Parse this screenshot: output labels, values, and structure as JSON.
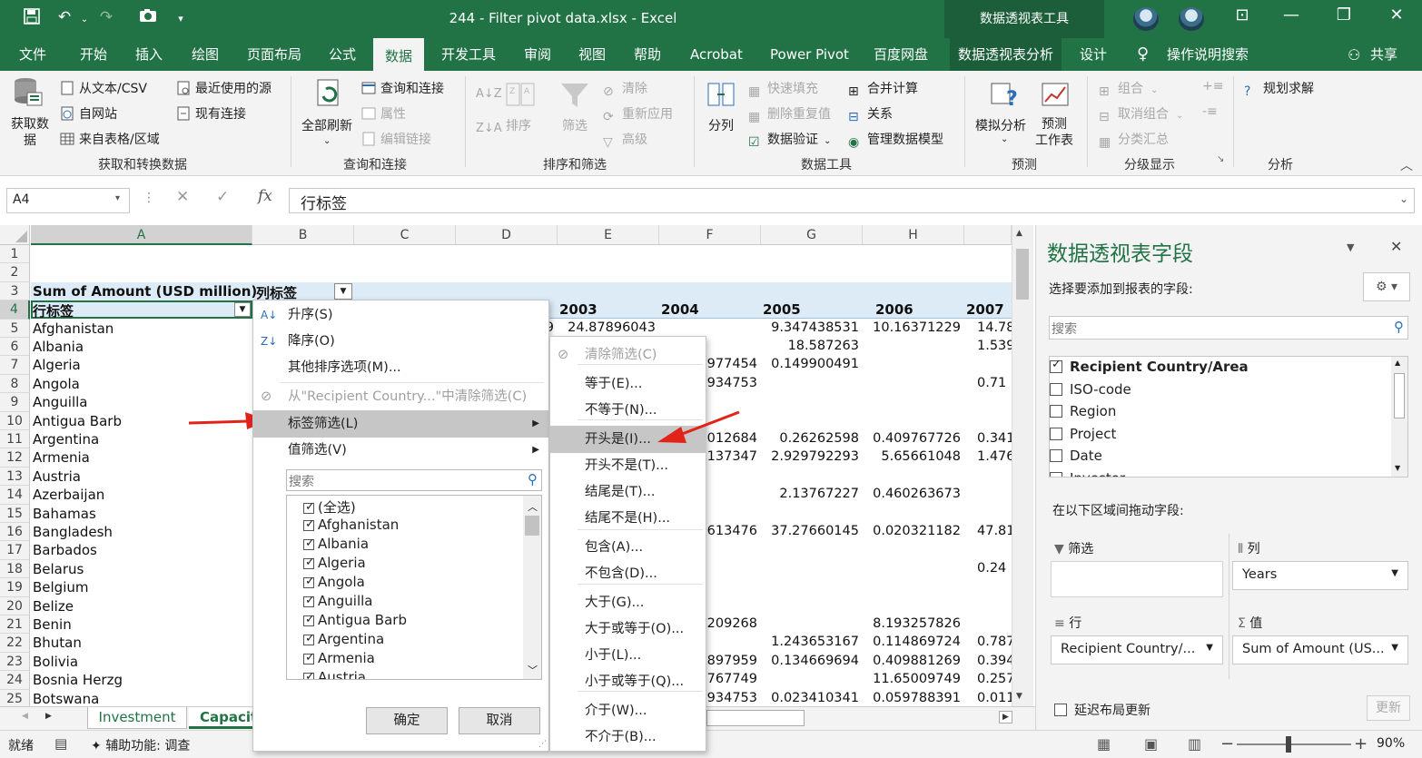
{
  "window": {
    "title": "244 - Filter pivot data.xlsx  -  Excel",
    "context_title": "数据透视表工具"
  },
  "tabs": [
    "文件",
    "开始",
    "插入",
    "绘图",
    "页面布局",
    "公式",
    "数据",
    "开发工具",
    "审阅",
    "视图",
    "帮助",
    "Acrobat",
    "Power Pivot",
    "百度网盘",
    "数据透视表分析",
    "设计",
    "操作说明搜索",
    "共享"
  ],
  "ribbon": {
    "get_data": "获取数\n据",
    "from_text": "从文本/CSV",
    "from_web": "自网站",
    "from_table": "来自表格/区域",
    "recent": "最近使用的源",
    "existing": "现有连接",
    "grp1": "获取和转换数据",
    "refresh_all": "全部刷新",
    "queries": "查询和连接",
    "properties": "属性",
    "edit_links": "编辑链接",
    "grp2": "查询和连接",
    "sort": "排序",
    "filter": "筛选",
    "clear": "清除",
    "reapply": "重新应用",
    "advanced": "高级",
    "grp3": "排序和筛选",
    "split": "分列",
    "flash_fill": "快速填充",
    "remove_dup": "删除重复值",
    "validation": "数据验证",
    "consolidate": "合并计算",
    "relations": "关系",
    "data_model": "管理数据模型",
    "grp4": "数据工具",
    "what_if": "模拟分析",
    "forecast": "预测\n工作表",
    "grp5": "预测",
    "group": "组合",
    "ungroup": "取消组合",
    "subtotal": "分类汇总",
    "grp6": "分级显示",
    "solver": "规划求解",
    "grp7": "分析"
  },
  "formula_bar": {
    "name_box": "A4",
    "fx": "fx",
    "content": "行标签"
  },
  "grid": {
    "columns": [
      "A",
      "B",
      "C",
      "D",
      "E",
      "F",
      "G",
      "H"
    ],
    "rows": [
      "1",
      "2",
      "3",
      "4",
      "5",
      "6",
      "7",
      "8",
      "9",
      "10",
      "11",
      "12",
      "13",
      "14",
      "15",
      "16",
      "17",
      "18",
      "19",
      "20",
      "21",
      "22",
      "23",
      "24",
      "25"
    ],
    "a3": "Sum of Amount (USD million)",
    "b3": "列标签",
    "a4": "行标签",
    "years": [
      "2003",
      "2004",
      "2005",
      "2006",
      "2007"
    ],
    "countries": [
      "Afghanistan",
      "Albania",
      "Algeria",
      "Angola",
      "Anguilla",
      "Antigua Barb",
      "Argentina",
      "Armenia",
      "Austria",
      "Azerbaijan",
      "Bahamas",
      "Bangladesh",
      "Barbados",
      "Belarus",
      "Belgium",
      "Belize",
      "Benin",
      "Bhutan",
      "Bolivia",
      "Bosnia Herzg",
      "Botswana"
    ],
    "d5": "9",
    "e5": "24.87896043",
    "vals": [
      [
        "",
        "9.347438531",
        "10.16371229",
        "14.78"
      ],
      [
        "",
        "18.587263",
        "",
        "1.539"
      ],
      [
        ".977454",
        "0.149900491",
        "",
        ""
      ],
      [
        ".934753",
        "",
        "",
        "0.71"
      ],
      [
        "",
        "",
        "",
        ""
      ],
      [
        "",
        "",
        "",
        ""
      ],
      [
        ".012684",
        "0.26262598",
        "0.409767726",
        "0.341"
      ],
      [
        ".137347",
        "2.929792293",
        "5.65661048",
        "1.476"
      ],
      [
        "",
        "",
        "",
        ""
      ],
      [
        "",
        "2.13767227",
        "0.460263673",
        ""
      ],
      [
        "",
        "",
        "",
        ""
      ],
      [
        ".613476",
        "37.27660145",
        "0.020321182",
        "47.81"
      ],
      [
        "",
        "",
        "",
        ""
      ],
      [
        "",
        "",
        "",
        "0.24"
      ],
      [
        "",
        "",
        "",
        ""
      ],
      [
        "",
        "",
        "",
        ""
      ],
      [
        ".209268",
        "",
        "8.193257826",
        ""
      ],
      [
        "",
        "1.243653167",
        "0.114869724",
        "0.787"
      ],
      [
        ".897959",
        "0.134669694",
        "0.409881269",
        "0.394"
      ],
      [
        ".767749",
        "",
        "11.65009749",
        "0.257"
      ],
      [
        ".934753",
        "0.023410341",
        "0.059788391",
        "0.011"
      ]
    ]
  },
  "sheet_tabs": [
    "Investment",
    "Capacit"
  ],
  "status": {
    "ready": "就绪",
    "accessibility": "辅助功能: 调查",
    "zoom": "90%"
  },
  "menu1": {
    "sort_asc": "升序(S)",
    "sort_desc": "降序(O)",
    "more_sort": "其他排序选项(M)...",
    "clear_filter": "从\"Recipient Country...\"中清除筛选(C)",
    "label_filter": "标签筛选(L)",
    "value_filter": "值筛选(V)",
    "search_placeholder": "搜索",
    "list": [
      "(全选)",
      "Afghanistan",
      "Albania",
      "Algeria",
      "Angola",
      "Anguilla",
      "Antigua Barb",
      "Argentina",
      "Armenia",
      "Austria"
    ],
    "ok": "确定",
    "cancel": "取消"
  },
  "menu2": [
    "清除筛选(C)",
    "等于(E)...",
    "不等于(N)...",
    "开头是(I)...",
    "开头不是(T)...",
    "结尾是(T)...",
    "结尾不是(H)...",
    "包含(A)...",
    "不包含(D)...",
    "大于(G)...",
    "大于或等于(O)...",
    "小于(L)...",
    "小于或等于(Q)...",
    "介于(W)...",
    "不介于(B)..."
  ],
  "pane": {
    "title": "数据透视表字段",
    "subtitle": "选择要添加到报表的字段:",
    "search": "搜索",
    "fields": [
      {
        "name": "Recipient Country/Area",
        "checked": true
      },
      {
        "name": "ISO-code",
        "checked": false
      },
      {
        "name": "Region",
        "checked": false
      },
      {
        "name": "Project",
        "checked": false
      },
      {
        "name": "Date",
        "checked": false
      },
      {
        "name": "Investor",
        "checked": false
      }
    ],
    "drag_label": "在以下区域间拖动字段:",
    "filters": "筛选",
    "columns": "列",
    "rows": "行",
    "values": "值",
    "col_field": "Years",
    "row_field": "Recipient Country/...",
    "val_field": "Sum of Amount (US...",
    "defer": "延迟布局更新",
    "update": "更新"
  }
}
